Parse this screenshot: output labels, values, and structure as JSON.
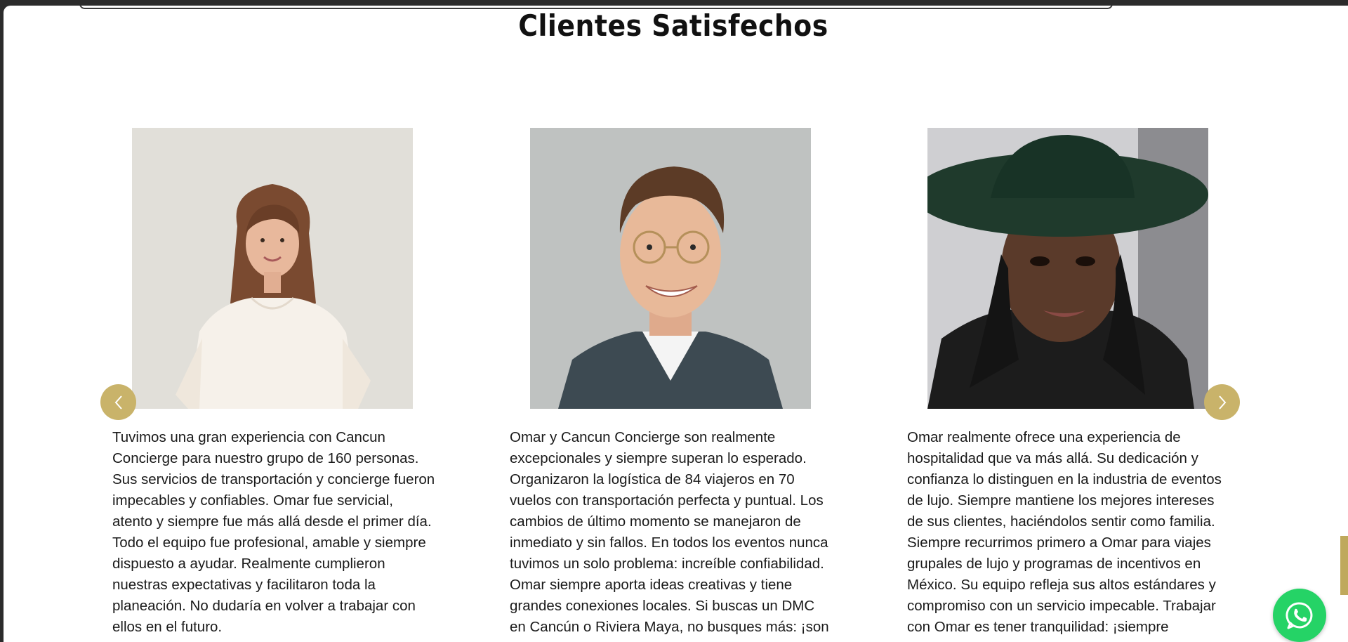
{
  "section": {
    "title": "Clientes Satisfechos"
  },
  "testimonials": [
    {
      "text": "Tuvimos una gran experiencia con Cancun Concierge para nuestro grupo de 160 personas. Sus servicios de transportación y concierge fueron impecables y confiables. Omar fue servicial, atento y siempre fue más allá desde el primer día. Todo el equipo fue profesional, amable y siempre dispuesto a ayudar. Realmente cumplieron nuestras expectativas y facilitaron toda la planeación. No dudaría en volver a trabajar con ellos en el futuro."
    },
    {
      "text": "Omar y Cancun Concierge son realmente excepcionales y siempre superan lo esperado. Organizaron la logística de 84 viajeros en 70 vuelos con transportación perfecta y puntual. Los cambios de último momento se manejaron de inmediato y sin fallos. En todos los eventos nunca tuvimos un solo problema: increíble confiabilidad. Omar siempre aporta ideas creativas y tiene grandes conexiones locales. Si buscas un DMC en Cancún o Riviera Maya, no busques más: ¡son los"
    },
    {
      "text": "Omar realmente ofrece una experiencia de hospitalidad que va más allá. Su dedicación y confianza lo distinguen en la industria de eventos de lujo. Siempre mantiene los mejores intereses de sus clientes, haciéndolos sentir como familia. Siempre recurrimos primero a Omar para viajes grupales de lujo y programas de incentivos en México. Su equipo refleja sus altos estándares y compromiso con un servicio impecable. Trabajar con Omar es tener tranquilidad: ¡siempre encuentra"
    }
  ],
  "colors": {
    "accent": "#c9b36a",
    "whatsapp": "#25d366"
  },
  "icons": {
    "prev": "chevron-left-icon",
    "next": "chevron-right-icon",
    "chat": "whatsapp-icon"
  }
}
